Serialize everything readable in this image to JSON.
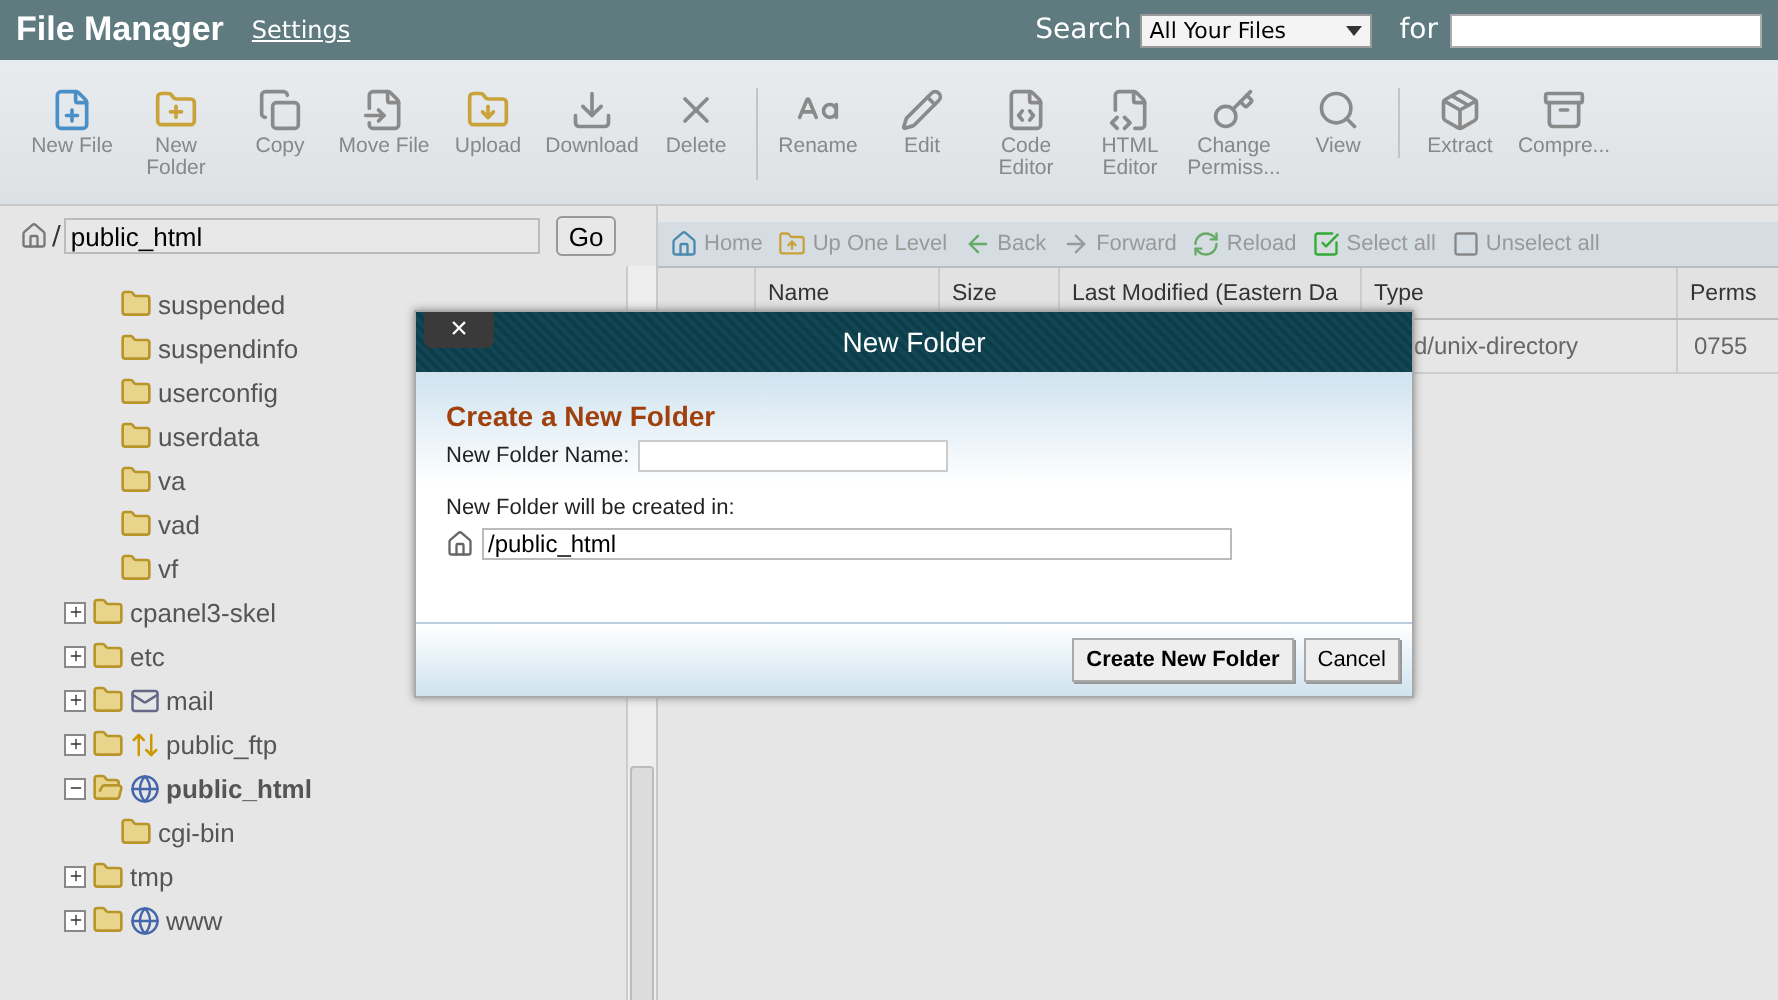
{
  "header": {
    "title": "File Manager",
    "settings_link": "Settings",
    "search_label": "Search",
    "search_scope": "All Your Files",
    "for_label": "for"
  },
  "toolbar": {
    "groups": [
      [
        "New File",
        "New Folder",
        "Copy",
        "Move File",
        "Upload",
        "Download",
        "Delete"
      ],
      [
        "Rename",
        "Edit",
        "Code Editor",
        "HTML Editor",
        "Change Permiss...",
        "View"
      ],
      [
        "Extract",
        "Compre..."
      ]
    ]
  },
  "path_bar": {
    "separator": "/",
    "value": "public_html",
    "go": "Go"
  },
  "tree": {
    "upper_items": [
      {
        "label": "suspended"
      },
      {
        "label": "suspendinfo"
      },
      {
        "label": "userconfig"
      },
      {
        "label": "userdata"
      },
      {
        "label": "va"
      },
      {
        "label": "vad"
      },
      {
        "label": "vf"
      }
    ],
    "items": [
      {
        "label": "cpanel3-skel",
        "kind": "folder",
        "expanded": false,
        "bold": false
      },
      {
        "label": "etc",
        "kind": "folder",
        "expanded": false,
        "bold": false
      },
      {
        "label": "mail",
        "kind": "mail",
        "expanded": false,
        "bold": false
      },
      {
        "label": "public_ftp",
        "kind": "ftp",
        "expanded": false,
        "bold": false
      },
      {
        "label": "public_html",
        "kind": "web",
        "expanded": true,
        "bold": true,
        "children": [
          {
            "label": "cgi-bin"
          }
        ]
      },
      {
        "label": "tmp",
        "kind": "folder",
        "expanded": false,
        "bold": false
      },
      {
        "label": "www",
        "kind": "web",
        "expanded": false,
        "bold": false
      }
    ]
  },
  "nav": [
    "Home",
    "Up One Level",
    "Back",
    "Forward",
    "Reload",
    "Select all",
    "Unselect all"
  ],
  "table": {
    "columns": [
      "Name",
      "Size",
      "Last Modified (Eastern Da",
      "Type",
      "Perms"
    ],
    "rows": [
      {
        "type": "d/unix-directory",
        "perms": "0755"
      }
    ]
  },
  "dialog": {
    "close": "×",
    "title": "New Folder",
    "heading": "Create a New Folder",
    "name_label": "New Folder Name:",
    "location_label": "New Folder will be created in:",
    "location_value": "/public_html",
    "buttons": [
      "Create New Folder",
      "Cancel"
    ]
  }
}
